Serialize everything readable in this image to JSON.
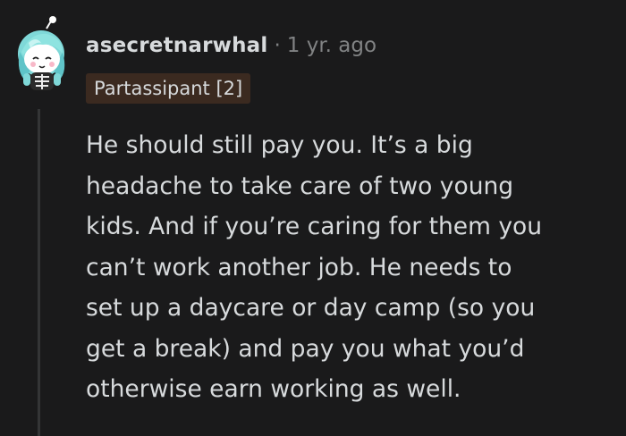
{
  "comment": {
    "username": "asecretnarwhal",
    "separator": "·",
    "timestamp": "1 yr. ago",
    "flair": "Partassipant [2]",
    "body": "He should still pay you. It’s a big\nheadache to take care of two young\nkids. And if you’re caring for them you\ncan’t work another job. He needs to\nset up a daycare or day camp (so you\nget a break) and pay you what you’d\notherwise earn working as well."
  },
  "colors": {
    "background": "#1a1a1b",
    "text": "#d7dadc",
    "muted": "#818384",
    "flair_background": "#3b2a20",
    "thread_line": "#343536",
    "avatar_hair": "#7fd8d8"
  },
  "icons": {
    "avatar": "snoo-avatar-icon"
  }
}
